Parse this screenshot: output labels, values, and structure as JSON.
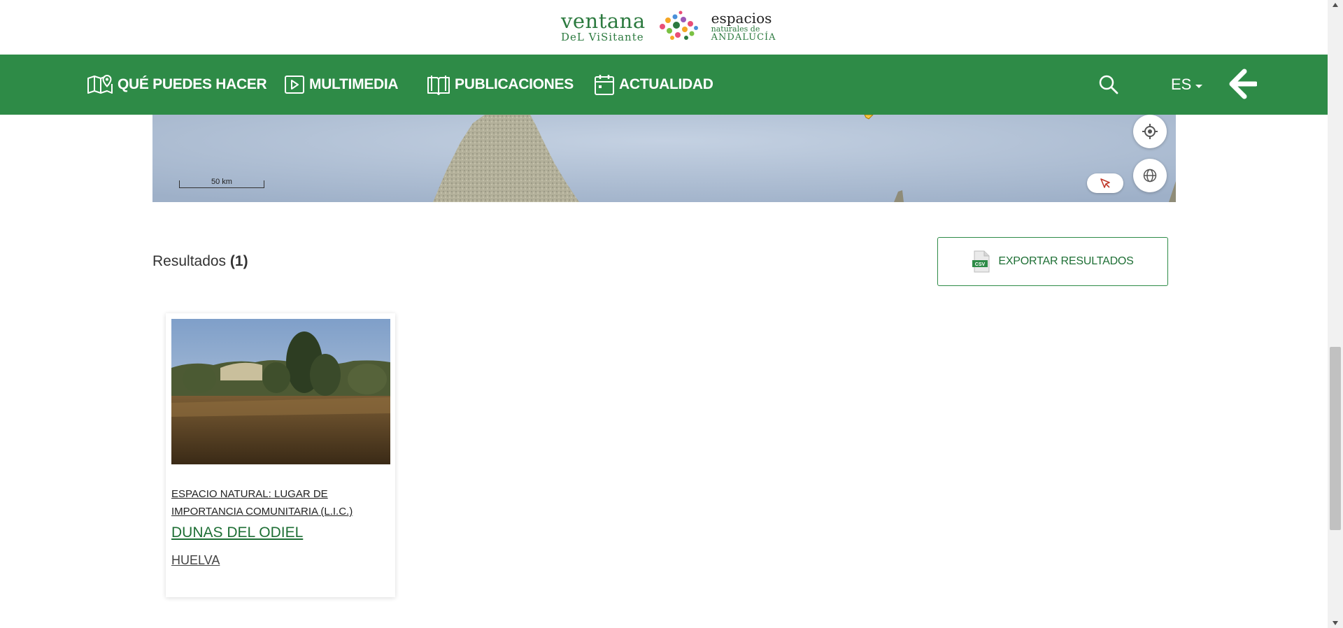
{
  "logo": {
    "line1": "ventana",
    "line2": "DeL ViSitante",
    "right1": "espacios",
    "right2": "naturales de",
    "right3": "ANDALUCÍA"
  },
  "nav": {
    "items": [
      {
        "label": "QUÉ PUEDES HACER",
        "icon": "map-pin-icon"
      },
      {
        "label": "MULTIMEDIA",
        "icon": "play-icon"
      },
      {
        "label": "PUBLICACIONES",
        "icon": "book-icon"
      },
      {
        "label": "ACTUALIDAD",
        "icon": "calendar-icon"
      }
    ],
    "search_icon": "search-icon",
    "language": "ES",
    "back_icon": "back-arrow-icon"
  },
  "map": {
    "scale_label": "50 km",
    "locate_icon": "crosshair-icon",
    "globe_icon": "globe-icon",
    "select_icon": "cursor-select-icon"
  },
  "results": {
    "label": "Resultados",
    "count": "(1)",
    "export_label": "EXPORTAR RESULTADOS",
    "export_icon": "csv-file-icon"
  },
  "cards": [
    {
      "type": "ESPACIO NATURAL: LUGAR DE IMPORTANCIA COMUNITARIA (L.I.C.)",
      "title": "DUNAS DEL ODIEL",
      "location": "HUELVA"
    }
  ],
  "colors": {
    "nav_green": "#2e8b47",
    "link_green": "#1e6f35"
  }
}
